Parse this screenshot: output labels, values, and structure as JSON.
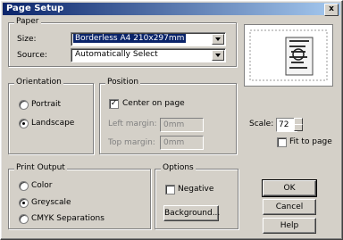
{
  "window": {
    "title": "Page Setup",
    "close_label": "x"
  },
  "paper": {
    "group_label": "Paper",
    "size_label": "Size:",
    "size_value": "Borderless A4 210x297mm",
    "source_label": "Source:",
    "source_value": "Automatically Select"
  },
  "orientation": {
    "group_label": "Orientation",
    "portrait": "Portrait",
    "landscape": "Landscape",
    "selected": "landscape"
  },
  "position": {
    "group_label": "Position",
    "center_label": "Center on page",
    "center_checked": true,
    "left_margin_label": "Left margin:",
    "left_margin_value": "0mm",
    "top_margin_label": "Top margin:",
    "top_margin_value": "0mm"
  },
  "scale": {
    "label": "Scale:",
    "value": "72",
    "fit_label": "Fit to page",
    "fit_checked": false
  },
  "print_output": {
    "group_label": "Print Output",
    "color": "Color",
    "greyscale": "Greyscale",
    "cmyk": "CMYK Separations",
    "selected": "greyscale"
  },
  "options": {
    "group_label": "Options",
    "negative_label": "Negative",
    "negative_checked": false,
    "background_button": "Background..."
  },
  "buttons": {
    "ok": "OK",
    "cancel": "Cancel",
    "help": "Help"
  }
}
